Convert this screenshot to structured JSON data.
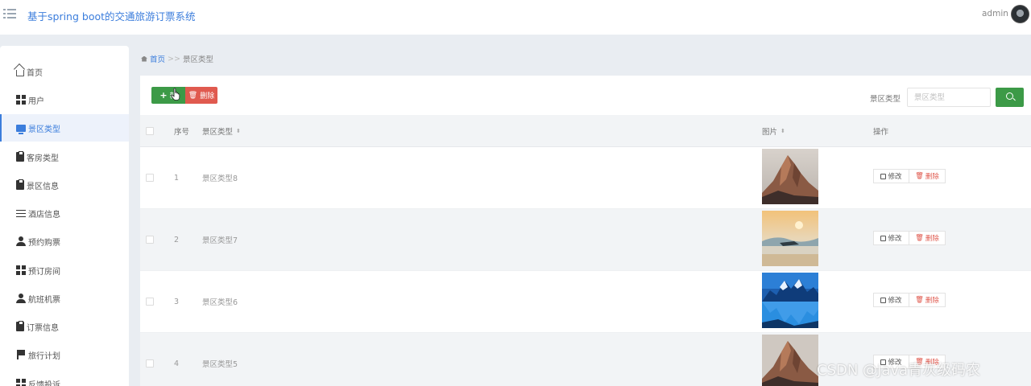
{
  "header": {
    "title": "基于spring boot的交通旅游订票系统",
    "user_name": "admin"
  },
  "sidebar": {
    "items": [
      {
        "label": "首页",
        "icon": "home-icon",
        "active": false
      },
      {
        "label": "用户",
        "icon": "grid-icon",
        "active": false
      },
      {
        "label": "景区类型",
        "icon": "screen-icon",
        "active": true
      },
      {
        "label": "客房类型",
        "icon": "clipboard-check-icon",
        "active": false
      },
      {
        "label": "景区信息",
        "icon": "clipboard-icon",
        "active": false
      },
      {
        "label": "酒店信息",
        "icon": "sliders-icon",
        "active": false
      },
      {
        "label": "预约购票",
        "icon": "user-icon",
        "active": false
      },
      {
        "label": "预订房间",
        "icon": "grid-icon",
        "active": false
      },
      {
        "label": "航班机票",
        "icon": "users-icon",
        "active": false
      },
      {
        "label": "订票信息",
        "icon": "clipboard-icon",
        "active": false
      },
      {
        "label": "旅行计划",
        "icon": "flag-icon",
        "active": false
      },
      {
        "label": "反馈投诉",
        "icon": "grid-icon",
        "active": false
      }
    ]
  },
  "breadcrumb": {
    "home": "首页",
    "separator": ">>",
    "current": "景区类型"
  },
  "toolbar": {
    "add_label": "新",
    "delete_label": "删除",
    "search_label": "景区类型",
    "search_placeholder": "景区类型",
    "search_value": ""
  },
  "table": {
    "columns": [
      "序号",
      "景区类型",
      "图片",
      "操作"
    ],
    "rows": [
      {
        "index": "1",
        "type": "景区类型8",
        "image": "mountain-peak",
        "edit": "修改",
        "delete": "删除"
      },
      {
        "index": "2",
        "type": "景区类型7",
        "image": "sunrise-lake",
        "edit": "修改",
        "delete": "删除"
      },
      {
        "index": "3",
        "type": "景区类型6",
        "image": "snow-mountain-lake",
        "edit": "修改",
        "delete": "删除"
      },
      {
        "index": "4",
        "type": "景区类型5",
        "image": "mountain-peak",
        "edit": "修改",
        "delete": "删除"
      }
    ]
  },
  "watermark": "CSDN @Java青灰级码农",
  "colors": {
    "accent": "#3b7ddc",
    "success": "#3c9a47",
    "danger": "#e05a4f"
  }
}
